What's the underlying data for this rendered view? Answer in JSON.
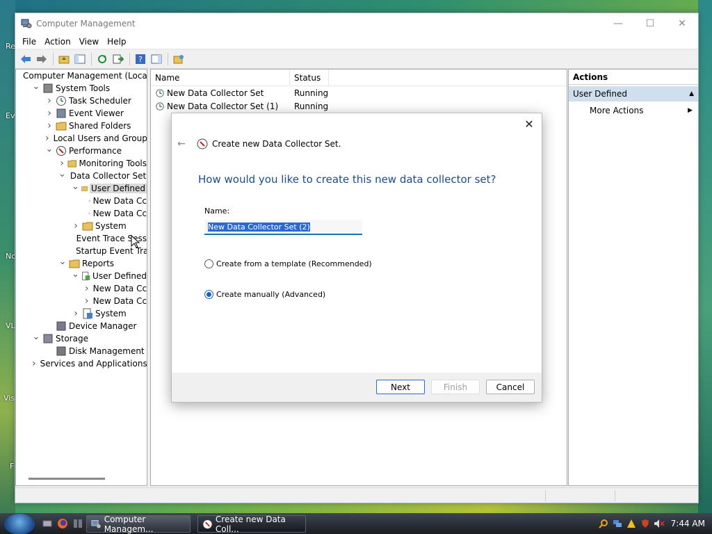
{
  "window": {
    "title": "Computer Management",
    "menu": [
      "File",
      "Action",
      "View",
      "Help"
    ]
  },
  "tree": [
    {
      "label": "Computer Management (Local",
      "indent": 0,
      "chev": "",
      "icon": "computer-management-icon"
    },
    {
      "label": "System Tools",
      "indent": 1,
      "chev": "down",
      "icon": "tools-icon"
    },
    {
      "label": "Task Scheduler",
      "indent": 2,
      "chev": "right",
      "icon": "clock-icon"
    },
    {
      "label": "Event Viewer",
      "indent": 2,
      "chev": "right",
      "icon": "event-viewer-icon"
    },
    {
      "label": "Shared Folders",
      "indent": 2,
      "chev": "right",
      "icon": "shared-folder-icon"
    },
    {
      "label": "Local Users and Groups",
      "indent": 2,
      "chev": "right",
      "icon": "users-icon"
    },
    {
      "label": "Performance",
      "indent": 2,
      "chev": "down",
      "icon": "performance-icon"
    },
    {
      "label": "Monitoring Tools",
      "indent": 3,
      "chev": "right",
      "icon": "folder-icon"
    },
    {
      "label": "Data Collector Sets",
      "indent": 3,
      "chev": "down",
      "icon": "folder-icon"
    },
    {
      "label": "User Defined",
      "indent": 4,
      "chev": "down",
      "icon": "user-folder-icon",
      "selected": true
    },
    {
      "label": "New Data Cc",
      "indent": 5,
      "chev": "",
      "icon": "data-collector-icon"
    },
    {
      "label": "New Data Cc",
      "indent": 5,
      "chev": "",
      "icon": "data-collector-icon"
    },
    {
      "label": "System",
      "indent": 4,
      "chev": "right",
      "icon": "folder-icon"
    },
    {
      "label": "Event Trace Sess",
      "indent": 4,
      "chev": "",
      "icon": "folder-icon"
    },
    {
      "label": "Startup Event Tra",
      "indent": 4,
      "chev": "",
      "icon": "folder-icon"
    },
    {
      "label": "Reports",
      "indent": 3,
      "chev": "down",
      "icon": "reports-folder-icon"
    },
    {
      "label": "User Defined",
      "indent": 4,
      "chev": "down",
      "icon": "report-user-icon"
    },
    {
      "label": "New Data Cc",
      "indent": 5,
      "chev": "right",
      "icon": "report-icon"
    },
    {
      "label": "New Data Cc",
      "indent": 5,
      "chev": "right",
      "icon": "report-icon"
    },
    {
      "label": "System",
      "indent": 4,
      "chev": "right",
      "icon": "report-system-icon"
    },
    {
      "label": "Device Manager",
      "indent": 2,
      "chev": "",
      "icon": "device-manager-icon"
    },
    {
      "label": "Storage",
      "indent": 1,
      "chev": "down",
      "icon": "storage-icon"
    },
    {
      "label": "Disk Management",
      "indent": 2,
      "chev": "",
      "icon": "disk-icon"
    },
    {
      "label": "Services and Applications",
      "indent": 1,
      "chev": "right",
      "icon": "services-icon"
    }
  ],
  "list": {
    "columns": [
      "Name",
      "Status"
    ],
    "rows": [
      {
        "name": "New Data Collector Set",
        "status": "Running"
      },
      {
        "name": "New Data Collector Set (1)",
        "status": "Running"
      }
    ]
  },
  "actions": {
    "header": "Actions",
    "section": "User Defined",
    "items": [
      "More Actions"
    ]
  },
  "dialog": {
    "title": "Create new Data Collector Set.",
    "question": "How would you like to create this new data collector set?",
    "name_label": "Name:",
    "name_value": "New Data Collector Set (2)",
    "option_template": "Create from a template (Recommended)",
    "option_manual": "Create manually (Advanced)",
    "selected_option": "manual",
    "buttons": {
      "next": "Next",
      "finish": "Finish",
      "cancel": "Cancel"
    }
  },
  "taskbar": {
    "tasks": [
      "Computer Managem...",
      "Create new Data Coll..."
    ],
    "clock": "7:44 AM"
  },
  "desktop": {
    "labels": [
      "Re",
      "Ev",
      "No",
      "VL",
      "Vis",
      "F"
    ]
  },
  "colors": {
    "accent": "#1f5fb0",
    "question": "#1c4a8a",
    "selection": "#2a6ad0"
  }
}
